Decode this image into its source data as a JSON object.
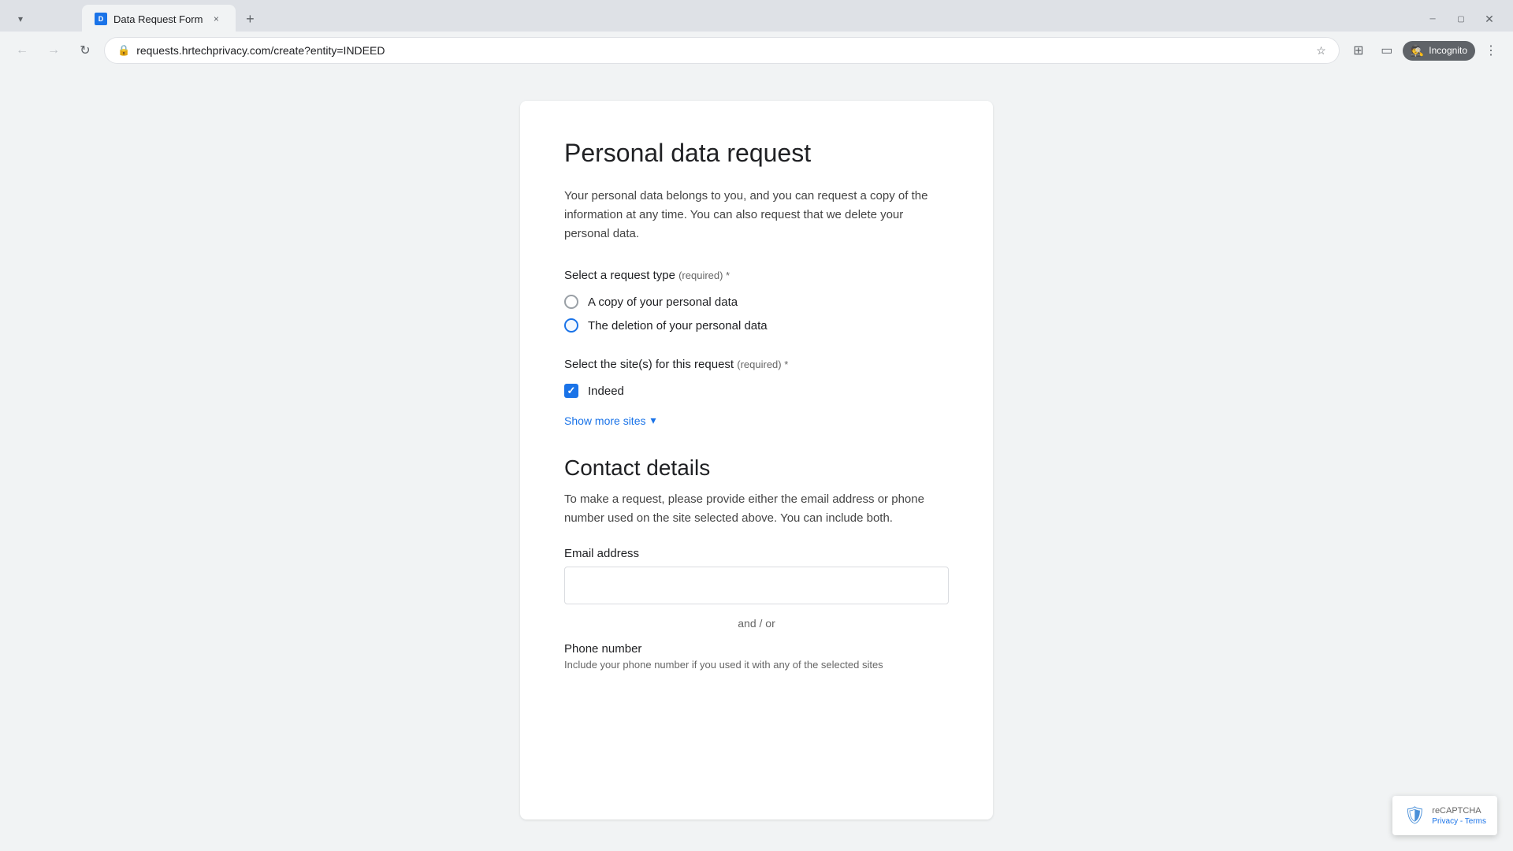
{
  "browser": {
    "tab": {
      "title": "Data Request Form",
      "favicon": "D"
    },
    "url": "requests.hrtechprivacy.com/create?entity=INDEED",
    "new_tab_label": "+",
    "incognito_label": "Incognito"
  },
  "form": {
    "title": "Personal data request",
    "description": "Your personal data belongs to you, and you can request a copy of the information at any time. You can also request that we delete your personal data.",
    "request_type": {
      "label": "Select a request type",
      "required_label": "(required) *",
      "options": [
        {
          "id": "copy",
          "label": "A copy of your personal data",
          "selected": false
        },
        {
          "id": "deletion",
          "label": "The deletion of your personal data",
          "selected": false
        }
      ]
    },
    "sites": {
      "label": "Select the site(s) for this request",
      "required_label": "(required) *",
      "options": [
        {
          "id": "indeed",
          "label": "Indeed",
          "checked": true
        }
      ],
      "show_more_label": "Show more sites"
    },
    "contact": {
      "title": "Contact details",
      "description": "To make a request, please provide either the email address or phone number used on the site selected above. You can include both.",
      "email_label": "Email address",
      "email_placeholder": "",
      "and_or_label": "and / or",
      "phone_label": "Phone number",
      "phone_description": "Include your phone number if you used it with any of the selected sites"
    }
  },
  "recaptcha": {
    "label": "reCAPTCHA",
    "subtext": "Privacy - Terms"
  },
  "icons": {
    "back": "←",
    "forward": "→",
    "refresh": "↻",
    "lock": "🔒",
    "star": "☆",
    "profile": "⊙",
    "menu": "⋮",
    "extensions": "⊞",
    "close_tab": "×",
    "chevron_down": "▾"
  }
}
